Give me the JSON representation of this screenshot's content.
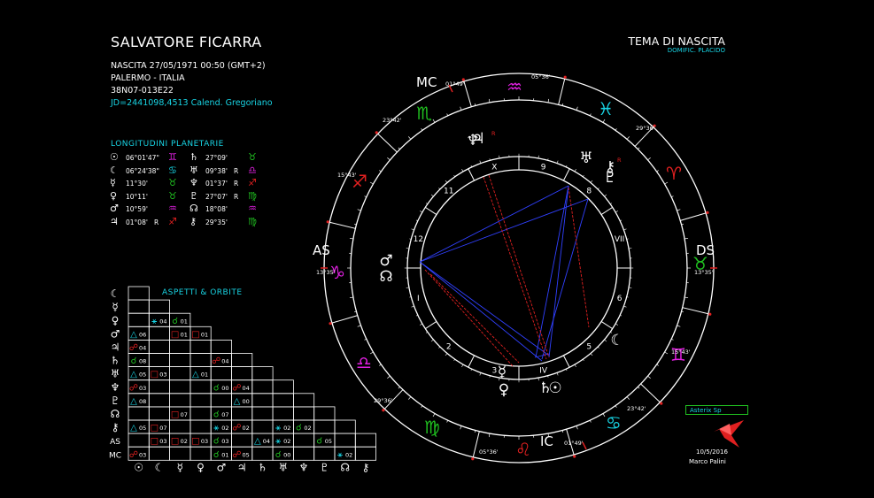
{
  "header": {
    "name": "SALVATORE FICARRA",
    "birth": "NASCITA 27/05/1971 00:50 (GMT+2)",
    "place": "PALERMO - ITALIA",
    "coords": "38N07-013E22",
    "julian": "JD=2441098,4513  Calend. Gregoriano"
  },
  "chart_header": {
    "title": "TEMA DI NASCITA",
    "subtitle": "DOMIFIC. PLACIDO"
  },
  "longitudes": {
    "title": "LONGITUDINI PLANETARIE",
    "left": [
      {
        "planet": "☉",
        "value": "06°01'47\"",
        "retro": "",
        "sign": "♊",
        "color": "#e020e0"
      },
      {
        "planet": "☾",
        "value": "06°24'38\"",
        "retro": "",
        "sign": "♋",
        "color": "#18d4e4"
      },
      {
        "planet": "☿",
        "value": "11°30'",
        "retro": "",
        "sign": "♉",
        "color": "#20c020"
      },
      {
        "planet": "♀",
        "value": "10°11'",
        "retro": "",
        "sign": "♉",
        "color": "#20c020"
      },
      {
        "planet": "♂",
        "value": "10°59'",
        "retro": "",
        "sign": "♒",
        "color": "#e020e0"
      },
      {
        "planet": "♃",
        "value": "01°08'",
        "retro": "R",
        "sign": "♐",
        "color": "#e02020"
      }
    ],
    "right": [
      {
        "planet": "♄",
        "value": "27°09'",
        "retro": "",
        "sign": "♉",
        "color": "#20c020"
      },
      {
        "planet": "♅",
        "value": "09°38'",
        "retro": "R",
        "sign": "♎",
        "color": "#e020e0"
      },
      {
        "planet": "♆",
        "value": "01°37'",
        "retro": "R",
        "sign": "♐",
        "color": "#e02020"
      },
      {
        "planet": "♇",
        "value": "27°07'",
        "retro": "R",
        "sign": "♍",
        "color": "#20c020"
      },
      {
        "planet": "☊",
        "value": "18°08'",
        "retro": "",
        "sign": "♒",
        "color": "#e020e0"
      },
      {
        "planet": "⚷",
        "value": "29°35'",
        "retro": "",
        "sign": "♍",
        "color": "#20c020"
      }
    ]
  },
  "aspects": {
    "title": "ASPETTI  &  ORBITE",
    "rows": [
      "☾",
      "☿",
      "♀",
      "♂",
      "♃",
      "♄",
      "♅",
      "♆",
      "♇",
      "☊",
      "⚷",
      "AS",
      "MC"
    ],
    "cols": [
      "☉",
      "☾",
      "☿",
      "♀",
      "♂",
      "♃",
      "♄",
      "♅",
      "♆",
      "♇",
      "☊",
      "⚷"
    ],
    "cells": [
      {
        "r": 2,
        "c": 1,
        "sym": "⚹",
        "orb": "04",
        "color": "#18d4e4"
      },
      {
        "r": 2,
        "c": 2,
        "sym": "☌",
        "orb": "01",
        "color": "#20c020"
      },
      {
        "r": 3,
        "c": 0,
        "sym": "△",
        "orb": "06",
        "color": "#18d4e4"
      },
      {
        "r": 3,
        "c": 2,
        "sym": "□",
        "orb": "01",
        "color": "#e02020"
      },
      {
        "r": 3,
        "c": 3,
        "sym": "□",
        "orb": "01",
        "color": "#e02020"
      },
      {
        "r": 4,
        "c": 0,
        "sym": "☍",
        "orb": "04",
        "color": "#e02020"
      },
      {
        "r": 5,
        "c": 0,
        "sym": "☌",
        "orb": "08",
        "color": "#20c020"
      },
      {
        "r": 5,
        "c": 4,
        "sym": "☍",
        "orb": "04",
        "color": "#e02020"
      },
      {
        "r": 6,
        "c": 0,
        "sym": "△",
        "orb": "05",
        "color": "#18d4e4"
      },
      {
        "r": 6,
        "c": 1,
        "sym": "□",
        "orb": "03",
        "color": "#e02020"
      },
      {
        "r": 6,
        "c": 3,
        "sym": "△",
        "orb": "01",
        "color": "#18d4e4"
      },
      {
        "r": 7,
        "c": 0,
        "sym": "☍",
        "orb": "03",
        "color": "#e02020"
      },
      {
        "r": 7,
        "c": 4,
        "sym": "☌",
        "orb": "00",
        "color": "#20c020"
      },
      {
        "r": 7,
        "c": 5,
        "sym": "☍",
        "orb": "04",
        "color": "#e02020"
      },
      {
        "r": 8,
        "c": 0,
        "sym": "△",
        "orb": "08",
        "color": "#18d4e4"
      },
      {
        "r": 8,
        "c": 5,
        "sym": "△",
        "orb": "00",
        "color": "#18d4e4"
      },
      {
        "r": 9,
        "c": 2,
        "sym": "□",
        "orb": "07",
        "color": "#e02020"
      },
      {
        "r": 9,
        "c": 4,
        "sym": "☌",
        "orb": "07",
        "color": "#20c020"
      },
      {
        "r": 10,
        "c": 0,
        "sym": "△",
        "orb": "05",
        "color": "#18d4e4"
      },
      {
        "r": 10,
        "c": 1,
        "sym": "□",
        "orb": "07",
        "color": "#e02020"
      },
      {
        "r": 10,
        "c": 4,
        "sym": "⚹",
        "orb": "02",
        "color": "#18d4e4"
      },
      {
        "r": 10,
        "c": 5,
        "sym": "☍",
        "orb": "02",
        "color": "#e02020"
      },
      {
        "r": 10,
        "c": 7,
        "sym": "⚹",
        "orb": "02",
        "color": "#18d4e4"
      },
      {
        "r": 10,
        "c": 8,
        "sym": "☌",
        "orb": "02",
        "color": "#20c020"
      },
      {
        "r": 11,
        "c": 1,
        "sym": "□",
        "orb": "03",
        "color": "#e02020"
      },
      {
        "r": 11,
        "c": 2,
        "sym": "□",
        "orb": "02",
        "color": "#e02020"
      },
      {
        "r": 11,
        "c": 3,
        "sym": "□",
        "orb": "03",
        "color": "#e02020"
      },
      {
        "r": 11,
        "c": 4,
        "sym": "☌",
        "orb": "03",
        "color": "#20c020"
      },
      {
        "r": 11,
        "c": 6,
        "sym": "△",
        "orb": "04",
        "color": "#18d4e4"
      },
      {
        "r": 11,
        "c": 7,
        "sym": "⚹",
        "orb": "02",
        "color": "#18d4e4"
      },
      {
        "r": 11,
        "c": 9,
        "sym": "☌",
        "orb": "05",
        "color": "#20c020"
      },
      {
        "r": 12,
        "c": 0,
        "sym": "☍",
        "orb": "03",
        "color": "#e02020"
      },
      {
        "r": 12,
        "c": 4,
        "sym": "☌",
        "orb": "01",
        "color": "#20c020"
      },
      {
        "r": 12,
        "c": 5,
        "sym": "☍",
        "orb": "05",
        "color": "#e02020"
      },
      {
        "r": 12,
        "c": 7,
        "sym": "☌",
        "orb": "00",
        "color": "#20c020"
      },
      {
        "r": 12,
        "c": 10,
        "sym": "⚹",
        "orb": "02",
        "color": "#18d4e4"
      }
    ]
  },
  "angles": {
    "asc": "AS",
    "dsc": "DS",
    "mc": "MC",
    "ic": "IC",
    "asc_deg": "13°35'",
    "dsc_deg": "13°35'",
    "mc_deg": "01°49'",
    "ic_deg": "01°49'"
  },
  "cusp_degrees": [
    "05°36'",
    "29°36'",
    "15°43'",
    "23°42'",
    "29°36'",
    "05°36'",
    "15°43'",
    "23°42'"
  ],
  "house_numbers": [
    "I",
    "2",
    "3",
    "IV",
    "5",
    "6",
    "VII",
    "8",
    "9",
    "X",
    "11",
    "12"
  ],
  "signs": [
    {
      "glyph": "♑",
      "color": "#e020e0"
    },
    {
      "glyph": "♎",
      "color": "#e020e0"
    },
    {
      "glyph": "♍",
      "color": "#20c020"
    },
    {
      "glyph": "♌",
      "color": "#e02020"
    },
    {
      "glyph": "♋",
      "color": "#18d4e4"
    },
    {
      "glyph": "♊",
      "color": "#e020e0"
    },
    {
      "glyph": "♉",
      "color": "#20c020"
    },
    {
      "glyph": "♈",
      "color": "#e02020"
    },
    {
      "glyph": "♓",
      "color": "#18d4e4"
    },
    {
      "glyph": "♒",
      "color": "#e020e0"
    },
    {
      "glyph": "♏",
      "color": "#20c020"
    },
    {
      "glyph": "♐",
      "color": "#e02020"
    }
  ],
  "planets_on_wheel": [
    "♆",
    "♃",
    "♅",
    "♇",
    "⚷",
    "♂",
    "☊",
    "☾",
    "☉",
    "♄",
    "♀",
    "☿"
  ],
  "retro_mark": "R",
  "footer": {
    "asteroid": "Asterix Sp",
    "date": "10/5/2016",
    "author": "Marco Palini"
  }
}
